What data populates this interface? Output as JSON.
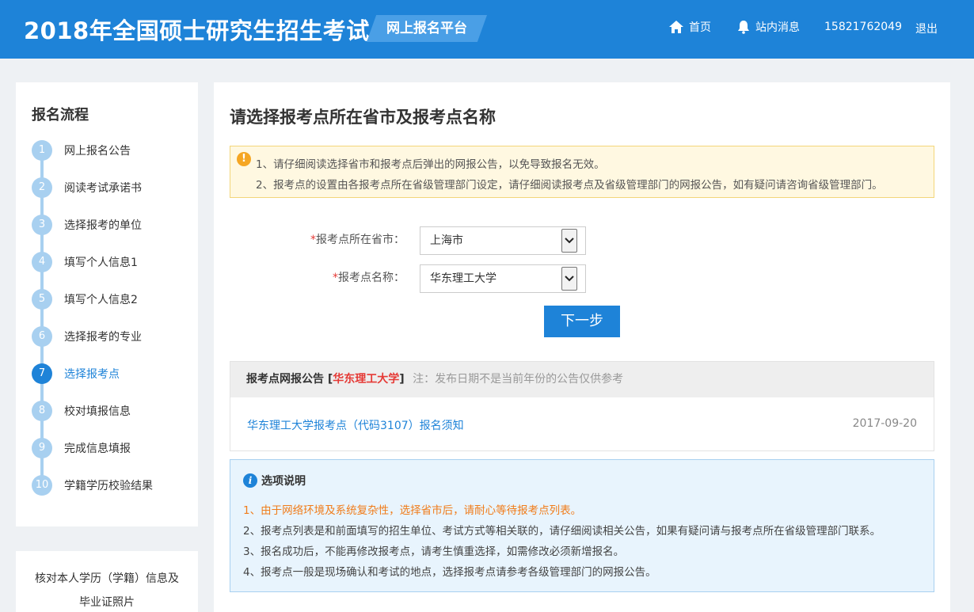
{
  "header": {
    "title": "2018年全国硕士研究生招生考试",
    "platform": "网上报名平台",
    "nav_home": "首页",
    "nav_messages": "站内消息",
    "nav_phone": "15821762049",
    "nav_logout": "退出",
    "brand_color": "#1e83d8"
  },
  "sidebar": {
    "title": "报名流程",
    "steps": [
      {
        "num": "1",
        "label": "网上报名公告"
      },
      {
        "num": "2",
        "label": "阅读考试承诺书"
      },
      {
        "num": "3",
        "label": "选择报考的单位"
      },
      {
        "num": "4",
        "label": "填写个人信息1"
      },
      {
        "num": "5",
        "label": "填写个人信息2"
      },
      {
        "num": "6",
        "label": "选择报考的专业"
      },
      {
        "num": "7",
        "label": "选择报考点"
      },
      {
        "num": "8",
        "label": "校对填报信息"
      },
      {
        "num": "9",
        "label": "完成信息填报"
      },
      {
        "num": "10",
        "label": "学籍学历校验结果"
      }
    ],
    "active_step": "7",
    "card2_line1": "核对本人学历（学籍）信息及",
    "card2_line2": "毕业证照片"
  },
  "main": {
    "title": "请选择报考点所在省市及报考点名称",
    "warning": {
      "line1": "1、请仔细阅读选择省市和报考点后弹出的网报公告，以免导致报名无效。",
      "line2": "2、报考点的设置由各报考点所在省级管理部门设定，请仔细阅读报考点及省级管理部门的网报公告，如有疑问请咨询省级管理部门。"
    },
    "form": {
      "required_mark": "*",
      "province_label": "报考点所在省市：",
      "province_value": "上海市",
      "site_label": "报考点名称：",
      "site_value": "华东理工大学",
      "next_button": "下一步"
    },
    "notice": {
      "head_prefix": "报考点网报公告 [",
      "head_univ": "华东理工大学",
      "head_suffix": "]",
      "head_note": "注：发布日期不是当前年份的公告仅供参考",
      "link_text": "华东理工大学报考点（代码3107）报名须知",
      "date": "2017-09-20"
    },
    "info": {
      "title": "选项说明",
      "lines": [
        "1、由于网络环境及系统复杂性，选择省市后，请耐心等待报考点列表。",
        "2、报考点列表是和前面填写的招生单位、考试方式等相关联的，请仔细阅读相关公告，如果有疑问请与报考点所在省级管理部门联系。",
        "3、报名成功后，不能再修改报考点，请考生慎重选择，如需修改必须新增报名。",
        "4、报考点一般是现场确认和考试的地点，选择报考点请参考各级管理部门的网报公告。"
      ]
    }
  }
}
